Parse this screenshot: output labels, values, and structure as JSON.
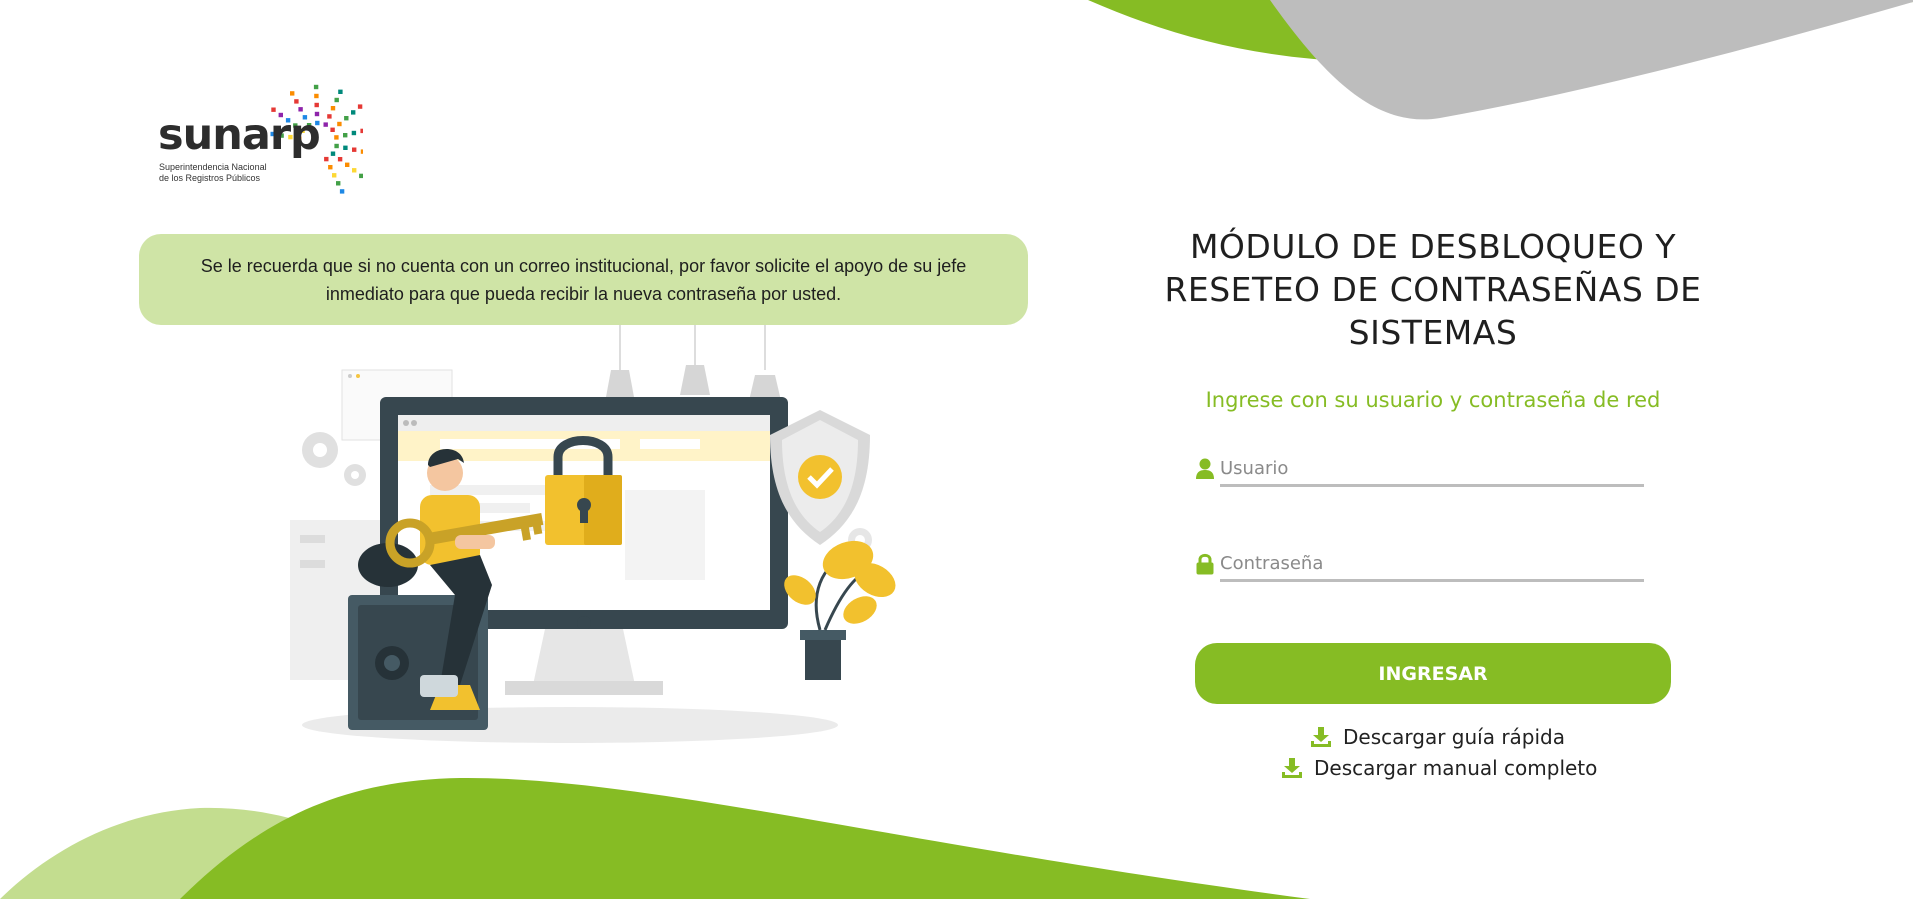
{
  "logo": {
    "wordmark": "sunarp",
    "tagline_line1": "Superintendencia Nacional",
    "tagline_line2": "de los Registros Públicos"
  },
  "notice": {
    "text": "Se le recuerda que si no cuenta con un correo institucional, por favor solicite el apoyo de su jefe inmediato para que pueda recibir la nueva contraseña por usted."
  },
  "login": {
    "title": "MÓDULO DE DESBLOQUEO Y RESETEO DE CONTRASEÑAS DE SISTEMAS",
    "subtitle": "Ingrese con su usuario y contraseña de red",
    "username": {
      "placeholder": "Usuario",
      "value": "",
      "icon": "user-icon"
    },
    "password": {
      "placeholder": "Contraseña",
      "value": "",
      "icon": "lock-icon"
    },
    "submit_label": "INGRESAR"
  },
  "downloads": {
    "guide_label": "Descargar guía rápida",
    "manual_label": "Descargar manual completo",
    "icon": "download-icon"
  },
  "colors": {
    "accent": "#86bc24",
    "accent_light": "#c3dd8f",
    "notice_bg": "#cfe4a6",
    "grey_shape": "#bdbdbd",
    "text": "#222222"
  }
}
